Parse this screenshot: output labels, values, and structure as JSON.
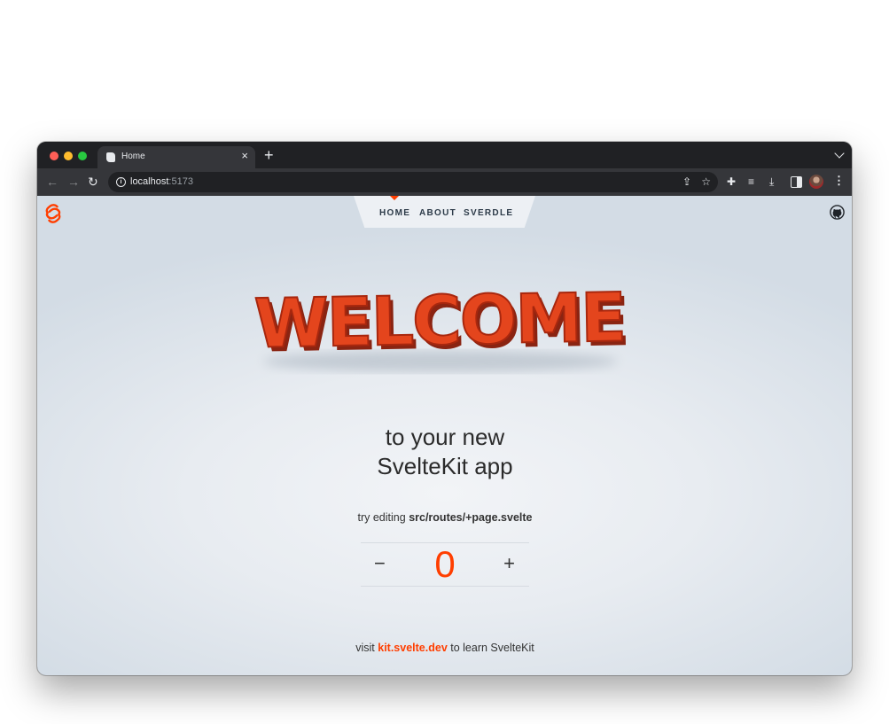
{
  "browser": {
    "tab_title": "Home",
    "tab_close": "×",
    "new_tab": "+",
    "url_host": "localhost",
    "url_port": ":5173"
  },
  "nav": {
    "links": [
      "HOME",
      "ABOUT",
      "SVERDLE"
    ],
    "active": "HOME"
  },
  "hero": {
    "welcome": "WELCOME",
    "headline_line1": "to your new",
    "headline_line2": "SvelteKit app"
  },
  "hint": {
    "prefix": "try editing",
    "path": "src/routes/+page.svelte"
  },
  "counter": {
    "minus": "−",
    "value": "0",
    "plus": "+"
  },
  "footer": {
    "prefix": "visit",
    "link": "kit.svelte.dev",
    "suffix": "to learn SvelteKit"
  },
  "colors": {
    "accent": "#ff3e00",
    "chrome_dark": "#202124",
    "chrome_toolbar": "#35363a"
  },
  "icons": [
    "svelte-logo-icon",
    "github-icon",
    "back-arrow-icon",
    "forward-arrow-icon",
    "reload-icon",
    "info-icon",
    "share-icon",
    "star-icon",
    "extensions-icon",
    "media-icon",
    "download-icon",
    "side-panel-icon",
    "avatar-icon",
    "kebab-menu-icon"
  ]
}
